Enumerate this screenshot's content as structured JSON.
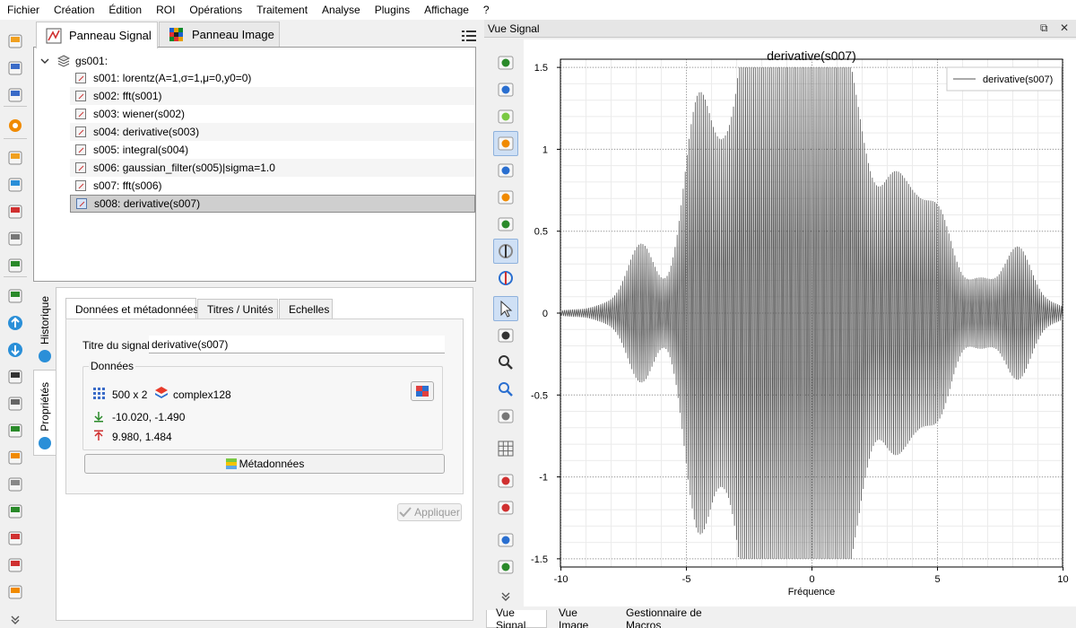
{
  "menubar": {
    "items": [
      "Fichier",
      "Création",
      "Édition",
      "ROI",
      "Opérations",
      "Traitement",
      "Analyse",
      "Plugins",
      "Affichage",
      "?"
    ]
  },
  "left_toolbar": {
    "icons": [
      "open-h5-icon",
      "save-h5-icon",
      "browse-h5-icon",
      "settings-icon",
      "open-signal-icon",
      "export-signal-icon",
      "save-signal-icon",
      "duplicate-icon",
      "chip-icon",
      "import-icon",
      "move-up-icon",
      "move-down-icon",
      "copy-icon",
      "delete-icon",
      "truck-icon",
      "paste-metadata-icon",
      "paste-icon",
      "add-icon",
      "delete-row-icon",
      "import-row-icon",
      "remove-row-icon",
      "more-icon"
    ]
  },
  "panel_tabs": {
    "signal": "Panneau Signal",
    "image": "Panneau Image"
  },
  "tree": {
    "group": "gs001:",
    "items": [
      "s001: lorentz(A=1,σ=1,μ=0,y0=0)",
      "s002: fft(s001)",
      "s003: wiener(s002)",
      "s004: derivative(s003)",
      "s005: integral(s004)",
      "s006: gaussian_filter(s005)|sigma=1.0",
      "s007: fft(s006)",
      "s008: derivative(s007)"
    ],
    "selected_index": 7
  },
  "side_tabs": {
    "historique": "Historique",
    "proprietes": "Propriétés"
  },
  "props": {
    "tabs": [
      "Données et métadonnées",
      "Titres / Unités",
      "Echelles"
    ],
    "titre_label": "Titre du signal",
    "titre_value": "derivative(s007)",
    "donnees_title": "Données",
    "shape": "500 x 2",
    "dtype": "complex128",
    "min_values": "-10.020, -1.490",
    "max_values": "9.980, 1.484",
    "metadata_button": "Métadonnées",
    "apply_button": "Appliquer"
  },
  "view": {
    "title": "Vue Signal",
    "bottom_tabs": [
      "Vue Signal",
      "Vue Image",
      "Gestionnaire de Macros"
    ]
  },
  "chart_data": {
    "type": "line",
    "title": "derivative(s007)",
    "xlabel": "Fréquence",
    "ylabel": "",
    "xlim": [
      -10.02,
      9.98
    ],
    "ylim": [
      -1.55,
      1.55
    ],
    "xticks": [
      -10,
      -5,
      0,
      5,
      10
    ],
    "yticks": [
      1.5,
      1,
      0.5,
      0,
      -0.5,
      -1,
      -1.5
    ],
    "grid": true,
    "legend_position": "top-right",
    "color": "#555555",
    "series": [
      {
        "name": "derivative(s007)",
        "n_points": 500,
        "envelope_peaks_x": [
          -9.6,
          -8.2,
          -6.8,
          -5.2,
          -4.5,
          -3.3,
          -2.2,
          -1.9,
          -0.8,
          0.2,
          1.2,
          2.0,
          3.2,
          4.1,
          5.1,
          6.7,
          8.2,
          9.6
        ],
        "envelope_peaks_y": [
          0.02,
          0.05,
          0.42,
          0.12,
          1.22,
          0.78,
          1.4,
          1.5,
          1.48,
          1.35,
          1.22,
          0.62,
          0.68,
          0.45,
          0.55,
          0.2,
          0.4,
          0.05
        ]
      }
    ]
  }
}
